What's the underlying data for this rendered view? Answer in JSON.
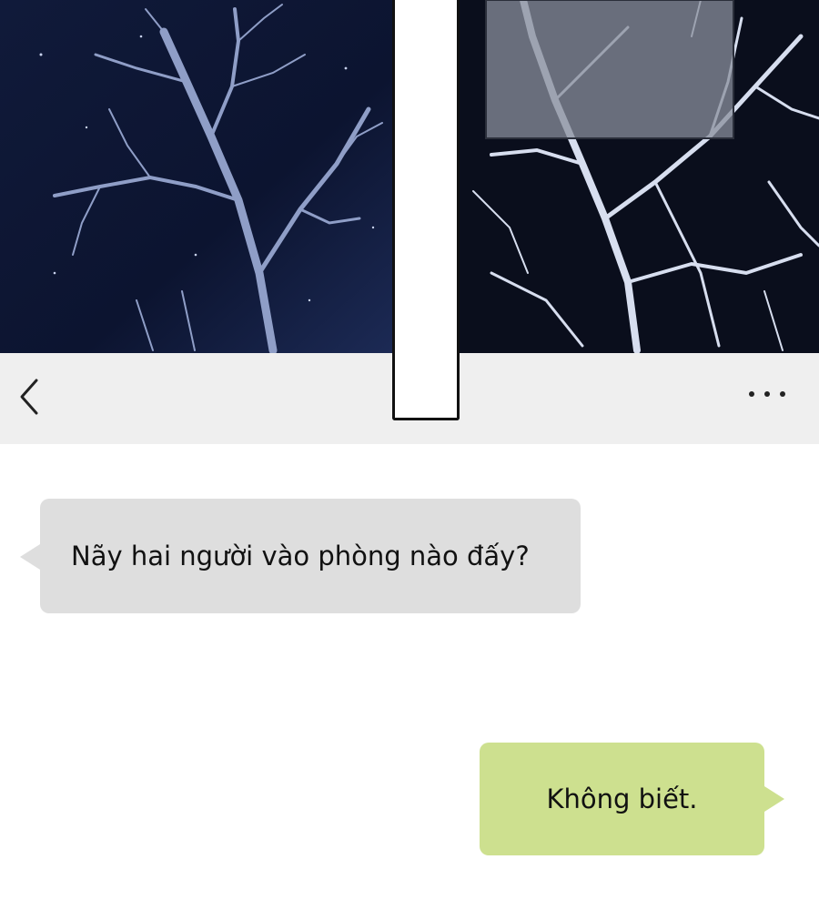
{
  "scene": {
    "image": "night-bare-trees-panels"
  },
  "navbar": {
    "back_icon": "chevron-left-icon",
    "more_icon": "more-horizontal-icon"
  },
  "messages": [
    {
      "side": "incoming",
      "text": "Nãy hai người vào phòng nào đấy?"
    },
    {
      "side": "outgoing",
      "text": "Không biết."
    }
  ],
  "colors": {
    "navbar_bg": "#efefef",
    "incoming_bubble": "#dedede",
    "outgoing_bubble": "#cde08f",
    "sky": "#0d1530"
  }
}
